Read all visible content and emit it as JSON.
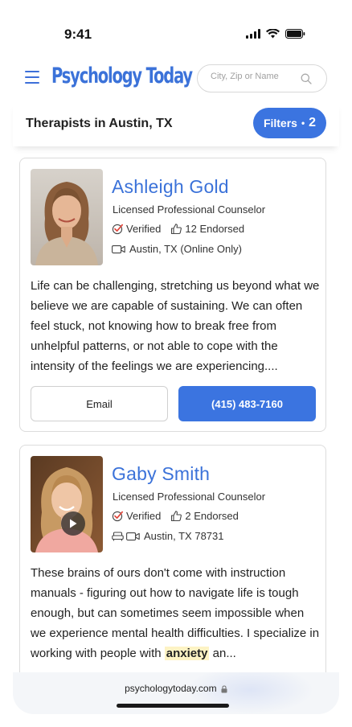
{
  "status_bar": {
    "time": "9:41"
  },
  "header": {
    "logo": "Psychology Today",
    "search_placeholder": "City, Zip or Name"
  },
  "title_bar": {
    "title": "Therapists in Austin, TX",
    "filters_label": "Filters",
    "filters_separator": "•",
    "filters_count": "2"
  },
  "therapists": [
    {
      "name": "Ashleigh Gold",
      "role": "Licensed Professional Counselor",
      "verified": "Verified",
      "endorsed": "12 Endorsed",
      "location": "Austin, TX (Online Only)",
      "bio": "Life can be challenging, stretching us beyond what we believe we are capable of sustaining. We can often feel stuck, not knowing how to break free from unhelpful patterns, or not able to cope with the intensity of the feelings we are experiencing....",
      "email_label": "Email",
      "phone_label": "(415) 483-7160",
      "photo_icon": "portrait-photo"
    },
    {
      "name": "Gaby Smith",
      "role": "Licensed Professional Counselor",
      "verified": "Verified",
      "endorsed": "2 Endorsed",
      "location": "Austin, TX 78731",
      "bio_before": "These brains of ours don't come with instruction manuals - figuring out how to navigate life is tough enough, but can sometimes seem impossible when we experience mental health difficulties. I specialize in working with people with ",
      "bio_highlight": "anxiety",
      "bio_after": " an...",
      "photo_icon": "portrait-photo",
      "video_icon": "play-icon"
    }
  ],
  "browser": {
    "url": "psychologytoday.com"
  },
  "colors": {
    "brand_blue": "#3b72d9",
    "button_blue": "#3b74e0",
    "verified_red": "#e0443a"
  }
}
